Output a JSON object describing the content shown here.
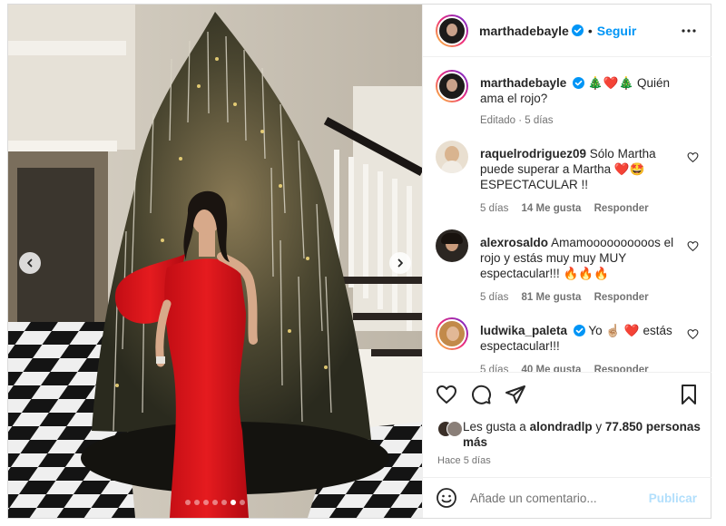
{
  "post": {
    "username": "marthadebayle",
    "follow_label": "Seguir",
    "separator": "•",
    "caption_user": "marthadebayle",
    "caption_text": "🎄❤️🎄 Quién ama el rojo?",
    "caption_meta": "Editado · 5 días",
    "carousel_total": 7,
    "carousel_active": 6
  },
  "comments": [
    {
      "user": "raquelrodriguez09",
      "text": "Sólo Martha puede superar a Martha ❤️🤩 ESPECTACULAR !!",
      "age": "5 días",
      "likes": "14 Me gusta",
      "reply": "Responder"
    },
    {
      "user": "alexrosaldo",
      "text": "Amamoooooooooos el rojo y estás muy muy MUY espectacular!!! 🔥🔥🔥",
      "age": "5 días",
      "likes": "81 Me gusta",
      "reply": "Responder"
    },
    {
      "user": "ludwika_paleta",
      "text": "Yo ☝🏼 ❤️ estás espectacular!!!",
      "age": "5 días",
      "likes": "40 Me gusta",
      "reply": "Responder"
    }
  ],
  "likes": {
    "prefix": "Les gusta a",
    "first_user": "alondradlp",
    "connector": "y",
    "others": "77.850 personas más"
  },
  "timestamp": "Hace 5 días",
  "add_comment": {
    "placeholder": "Añade un comentario...",
    "publish_label": "Publicar"
  },
  "colors": {
    "link_blue": "#0095f6",
    "publish_disabled": "#b2dffc",
    "meta_gray": "#737373",
    "verified_blue": "#0095f6"
  },
  "icons": [
    "verified-badge-icon",
    "more-options-icon",
    "heart-icon",
    "comment-icon",
    "share-icon",
    "save-icon",
    "emoji-icon",
    "chevron-left-icon",
    "chevron-right-icon"
  ]
}
